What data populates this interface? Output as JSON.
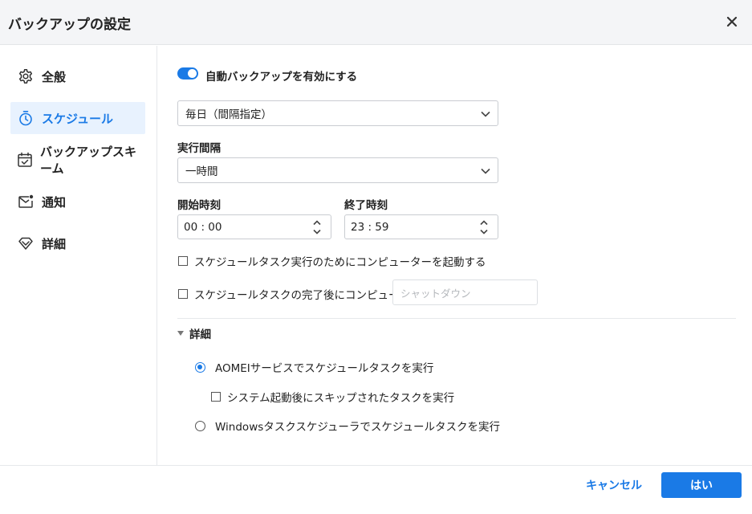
{
  "window": {
    "title": "バックアップの設定"
  },
  "colors": {
    "accent": "#1a7ae6",
    "active_bg": "#e8f2fe",
    "titlebar_bg": "#f4f5f7"
  },
  "sidebar": {
    "items": [
      {
        "label": "全般",
        "icon": "gear-icon",
        "active": false
      },
      {
        "label": "スケジュール",
        "icon": "stopwatch-icon",
        "active": true
      },
      {
        "label": "バックアップスキーム",
        "icon": "calendar-check-icon",
        "active": false
      },
      {
        "label": "通知",
        "icon": "mail-notification-icon",
        "active": false
      },
      {
        "label": "詳細",
        "icon": "diamond-icon",
        "active": false
      }
    ]
  },
  "schedule": {
    "enable_label": "自動バックアップを有効にする",
    "enabled": true,
    "frequency_value": "毎日（間隔指定）",
    "interval_label": "実行間隔",
    "interval_value": "一時間",
    "start_label": "開始時刻",
    "start_value": "00 : 00",
    "end_label": "終了時刻",
    "end_value": "23 : 59",
    "wake_label": "スケジュールタスク実行のためにコンピューターを起動する",
    "wake_checked": false,
    "after_label": "スケジュールタスクの完了後にコンピューターを",
    "after_checked": false,
    "after_placeholder": "シャットダウン"
  },
  "advanced": {
    "title": "詳細",
    "option_aomei": "AOMEIサービスでスケジュールタスクを実行",
    "option_skipped": "システム起動後にスキップされたタスクを実行",
    "option_windows": "Windowsタスクスケジューラでスケジュールタスクを実行",
    "selected": "aomei"
  },
  "footer": {
    "cancel_label": "キャンセル",
    "ok_label": "はい"
  }
}
